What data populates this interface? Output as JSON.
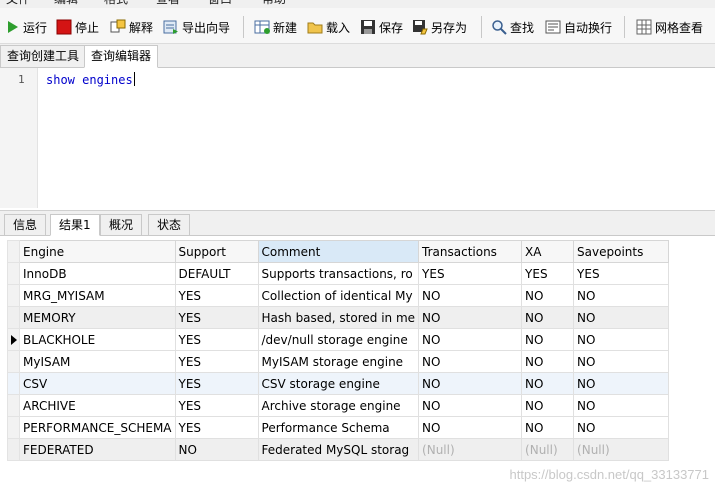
{
  "toolbar": {
    "run": "运行",
    "stop": "停止",
    "explain": "解释",
    "export_wizard": "导出向导",
    "new": "新建",
    "load": "载入",
    "save": "保存",
    "save_as": "另存为",
    "find": "查找",
    "word_wrap": "自动换行",
    "grid_view": "网格查看"
  },
  "query_tabs": [
    "查询创建工具",
    "查询编辑器"
  ],
  "editor": {
    "line_number": "1",
    "code": "show engines"
  },
  "result_tabs": [
    "信息",
    "结果1",
    "概况",
    "状态"
  ],
  "table": {
    "columns": [
      "Engine",
      "Support",
      "Comment",
      "Transactions",
      "XA",
      "Savepoints"
    ],
    "rows": [
      [
        "InnoDB",
        "DEFAULT",
        "Supports transactions, ro",
        "YES",
        "YES",
        "YES"
      ],
      [
        "MRG_MYISAM",
        "YES",
        "Collection of identical My",
        "NO",
        "NO",
        "NO"
      ],
      [
        "MEMORY",
        "YES",
        "Hash based, stored in me",
        "NO",
        "NO",
        "NO"
      ],
      [
        "BLACKHOLE",
        "YES",
        "/dev/null storage engine",
        "NO",
        "NO",
        "NO"
      ],
      [
        "MyISAM",
        "YES",
        "MyISAM storage engine",
        "NO",
        "NO",
        "NO"
      ],
      [
        "CSV",
        "YES",
        "CSV storage engine",
        "NO",
        "NO",
        "NO"
      ],
      [
        "ARCHIVE",
        "YES",
        "Archive storage engine",
        "NO",
        "NO",
        "NO"
      ],
      [
        "PERFORMANCE_SCHEMA",
        "YES",
        "Performance Schema",
        "NO",
        "NO",
        "NO"
      ],
      [
        "FEDERATED",
        "NO",
        "Federated MySQL storag",
        "(Null)",
        "(Null)",
        "(Null)"
      ]
    ]
  },
  "watermark": "https://blog.csdn.net/qq_33133771",
  "colors": {
    "accent_blue": "#0000cc",
    "sorted_header": "#d9e9f7",
    "null_text": "#b0b0b0"
  }
}
